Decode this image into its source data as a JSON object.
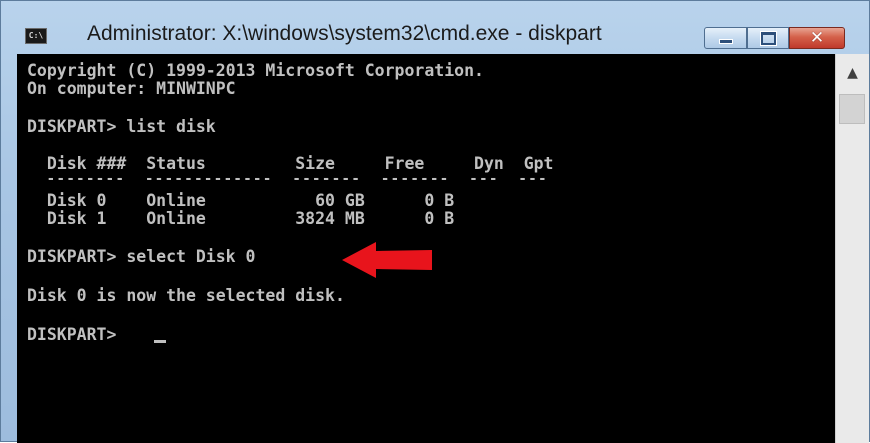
{
  "window": {
    "title": "Administrator: X:\\windows\\system32\\cmd.exe - diskpart",
    "icon": "cmd-icon",
    "controls": {
      "minimize": "minimize-icon",
      "maximize": "maximize-icon",
      "close": "close-icon"
    }
  },
  "console": {
    "lines": [
      "Copyright (C) 1999-2013 Microsoft Corporation.",
      "On computer: MINWINPC",
      "DISKPART> list disk",
      "  Disk ###  Status         Size     Free     Dyn  Gpt",
      "  --------  -------------  -------  -------  ---  ---",
      "  Disk 0    Online           60 GB      0 B",
      "  Disk 1    Online         3824 MB      0 B",
      "DISKPART> select Disk 0",
      "Disk 0 is now the selected disk.",
      "DISKPART> "
    ],
    "annotation_color": "#e8141c",
    "text_color": "#c0c0c0",
    "background": "#000000"
  },
  "scrollbar": {
    "up_icon": "chevron-up-icon"
  }
}
